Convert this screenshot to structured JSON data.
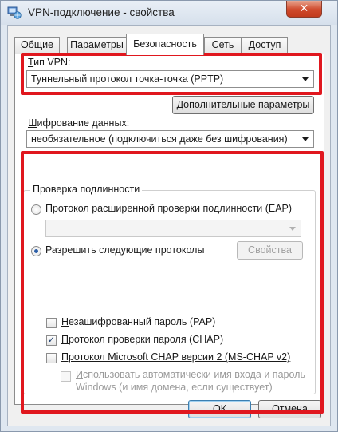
{
  "window": {
    "title": "VPN-подключение - свойства",
    "close_glyph": "✕"
  },
  "tabs": [
    {
      "label": "Общие",
      "active": false
    },
    {
      "label": "Параметры",
      "active": false
    },
    {
      "label": "Безопасность",
      "active": true
    },
    {
      "label": "Сеть",
      "active": false
    },
    {
      "label": "Доступ",
      "active": false
    }
  ],
  "security": {
    "vpn_type_label_ul": "Т",
    "vpn_type_label_rest": "ип VPN:",
    "vpn_type_value": "Туннельный протокол точка-точка (PPTP)",
    "advanced_button_pre": "Дополнител",
    "advanced_button_ul": "ь",
    "advanced_button_post": "ные параметры",
    "encryption_label_ul": "Ш",
    "encryption_label_rest": "ифрование данных:",
    "encryption_value": "необязательное (подключиться даже без шифрования)"
  },
  "auth": {
    "group_title": "Проверка подлинности",
    "eap_radio_label": "Протокол расширенной проверки подлинности (EAP)",
    "eap_radio_checked": false,
    "eap_combo_value": "",
    "allow_radio_pre": "Разрешить сле",
    "allow_radio_ul": "д",
    "allow_radio_post": "ующие протоколы",
    "allow_radio_checked": true,
    "properties_button": "Свойства",
    "pap_label_ul": "Н",
    "pap_label_rest": "езашифрованный пароль (PAP)",
    "pap_checked": false,
    "chap_label_ul": "П",
    "chap_label_rest": "ротокол проверки пароля (CHAP)",
    "chap_checked": true,
    "mschap_label": "Протокол Microsoft CHAP версии 2 (MS-CHAP v2)",
    "mschap_checked": false,
    "autologon_line1_ul": "И",
    "autologon_line1_rest": "спользовать автоматически имя входа и пароль",
    "autologon_line2": "Windows (и имя домена, если существует)",
    "autologon_checked": false,
    "check_mark": "✓"
  },
  "buttons": {
    "ok": "ОК",
    "cancel": "Отмена"
  },
  "colors": {
    "highlight": "#e0171e",
    "close_button": "#cf4a2c",
    "title_bar": "#dfe7f0"
  },
  "icons": {
    "title": "network-connection-icon",
    "close": "close-icon",
    "dropdown": "chevron-down-icon"
  }
}
